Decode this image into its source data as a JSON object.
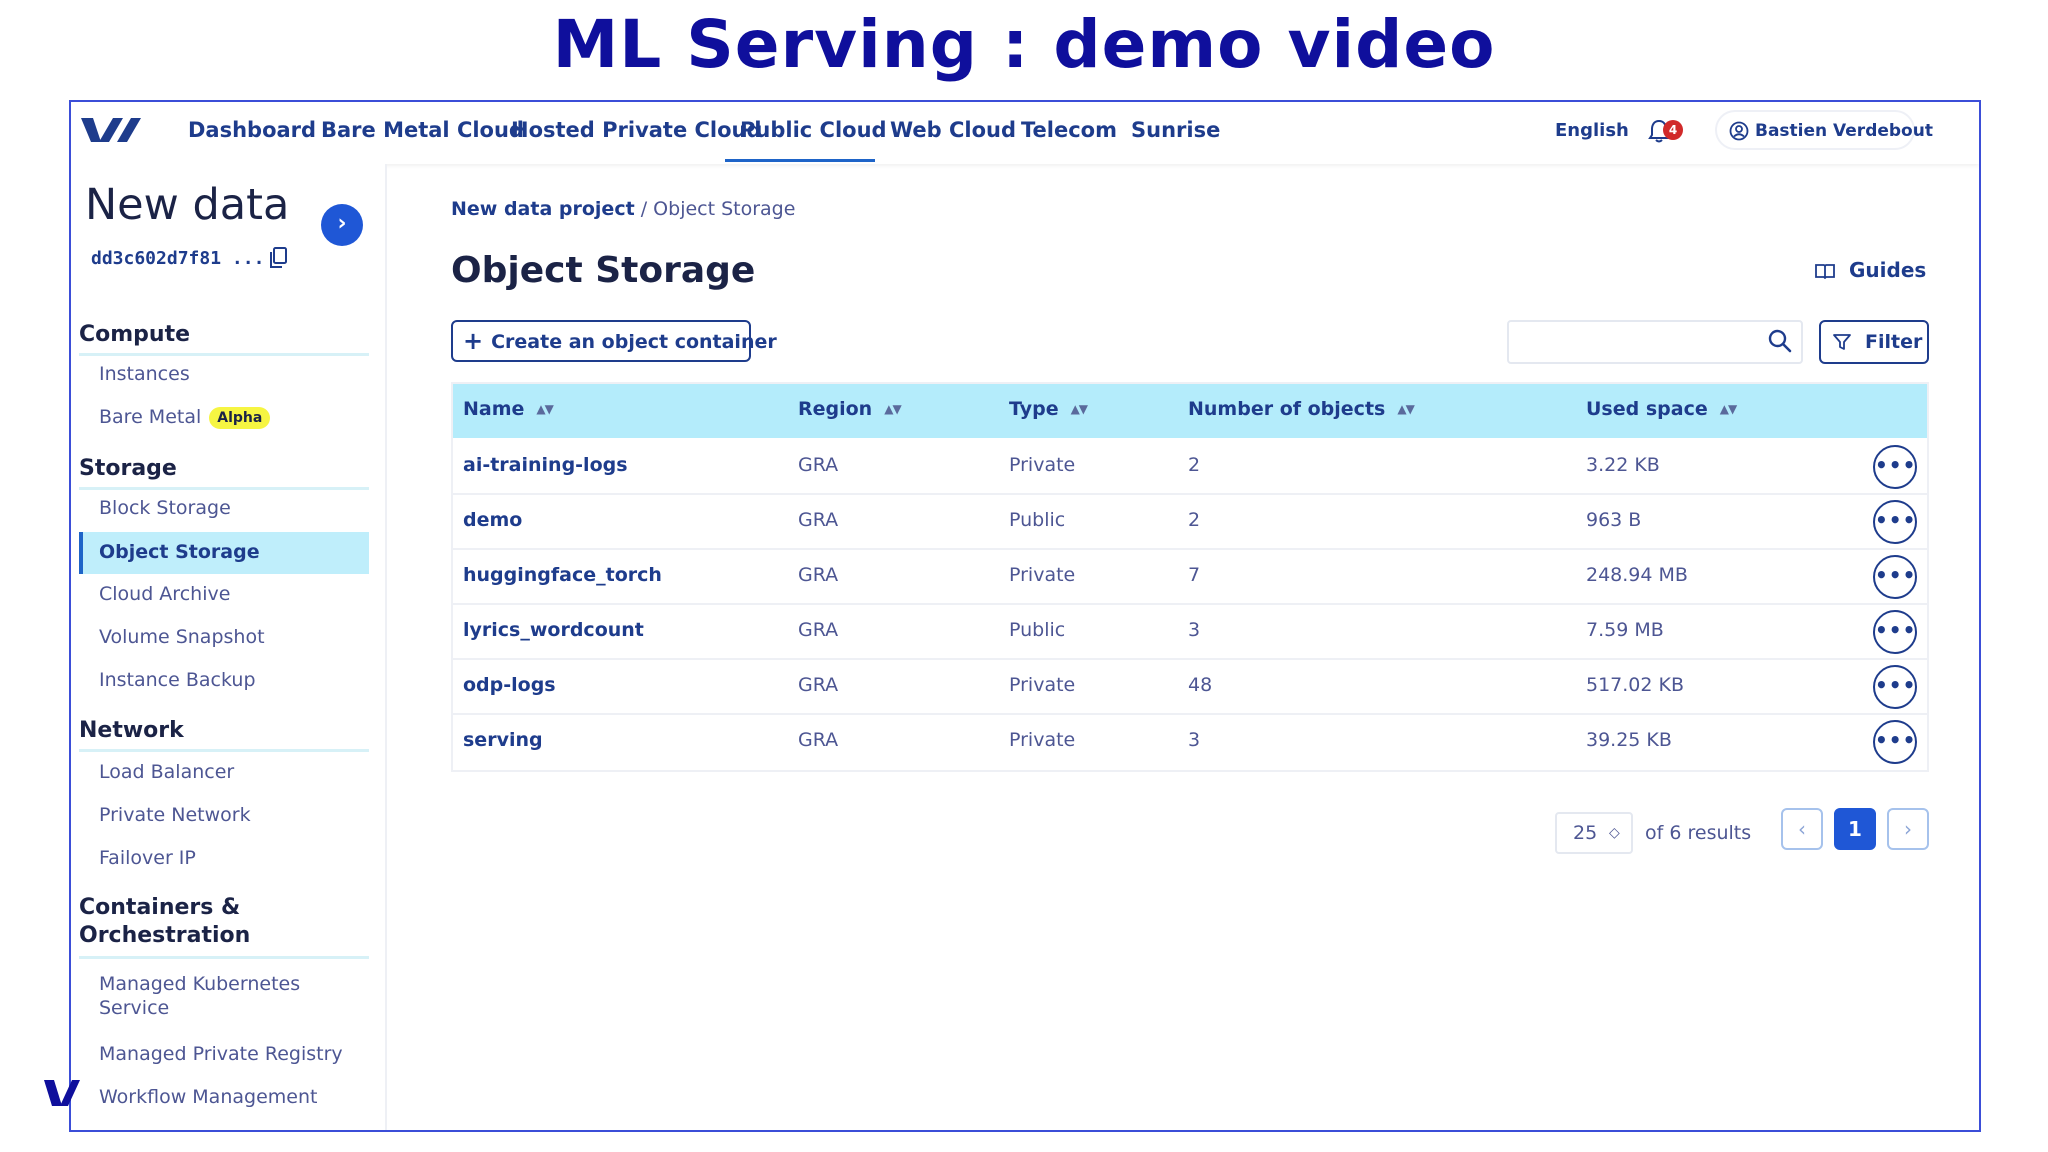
{
  "slide": {
    "title": "ML Serving : demo video"
  },
  "topnav": {
    "items": [
      "Dashboard",
      "Bare Metal Cloud",
      "Hosted Private Cloud",
      "Public Cloud",
      "Web Cloud",
      "Telecom",
      "Sunrise"
    ],
    "active": "Public Cloud",
    "language": "English",
    "notifications": "4",
    "user": "Bastien Verdebout"
  },
  "sidebar": {
    "project_title": "New data project",
    "project_id": "dd3c602d7f81",
    "project_id_ellipsis": "...",
    "expand_glyph": "›",
    "compute": {
      "heading": "Compute",
      "items": [
        "Instances",
        "Bare Metal"
      ],
      "badge": "Alpha"
    },
    "storage": {
      "heading": "Storage",
      "items": [
        "Block Storage",
        "Object Storage",
        "Cloud Archive",
        "Volume Snapshot",
        "Instance Backup"
      ]
    },
    "network": {
      "heading": "Network",
      "items": [
        "Load Balancer",
        "Private Network",
        "Failover IP"
      ]
    },
    "containers": {
      "heading": "Containers & Orchestration",
      "items": [
        "Managed Kubernetes Service",
        "Managed Private Registry",
        "Workflow Management"
      ]
    }
  },
  "main": {
    "breadcrumb": {
      "parent": "New data project",
      "separator": "/",
      "current": "Object Storage"
    },
    "title": "Object Storage",
    "guides": "Guides",
    "create_button": "Create an object container",
    "search_placeholder": "",
    "filter": "Filter",
    "table": {
      "columns": [
        "Name",
        "Region",
        "Type",
        "Number of objects",
        "Used space"
      ],
      "rows": [
        {
          "name": "ai-training-logs",
          "region": "GRA",
          "type": "Private",
          "objects": "2",
          "used": "3.22 KB"
        },
        {
          "name": "demo",
          "region": "GRA",
          "type": "Public",
          "objects": "2",
          "used": "963 B"
        },
        {
          "name": "huggingface_torch",
          "region": "GRA",
          "type": "Private",
          "objects": "7",
          "used": "248.94 MB"
        },
        {
          "name": "lyrics_wordcount",
          "region": "GRA",
          "type": "Public",
          "objects": "3",
          "used": "7.59 MB"
        },
        {
          "name": "odp-logs",
          "region": "GRA",
          "type": "Private",
          "objects": "48",
          "used": "517.02 KB"
        },
        {
          "name": "serving",
          "region": "GRA",
          "type": "Private",
          "objects": "3",
          "used": "39.25 KB"
        }
      ],
      "row_menu_glyph": "•••"
    },
    "pagination": {
      "per_page": "25",
      "results": "of 6 results",
      "prev": "‹",
      "current": "1",
      "next": "›"
    }
  },
  "colors": {
    "brand": "#1e3c8c",
    "accent": "#1f57d6",
    "slide_title": "#0f0f9c",
    "table_header": "#b4ecfb",
    "active_item": "#bfeefb",
    "alpha_badge": "#f6f542",
    "notification": "#d12a2a"
  },
  "icons": [
    "ovh-logo",
    "bell-icon",
    "user-icon",
    "copy-icon",
    "chevron-right-icon",
    "guides-icon",
    "plus-icon",
    "search-icon",
    "filter-icon",
    "sort-icon",
    "more-icon",
    "chevron-left-icon"
  ]
}
